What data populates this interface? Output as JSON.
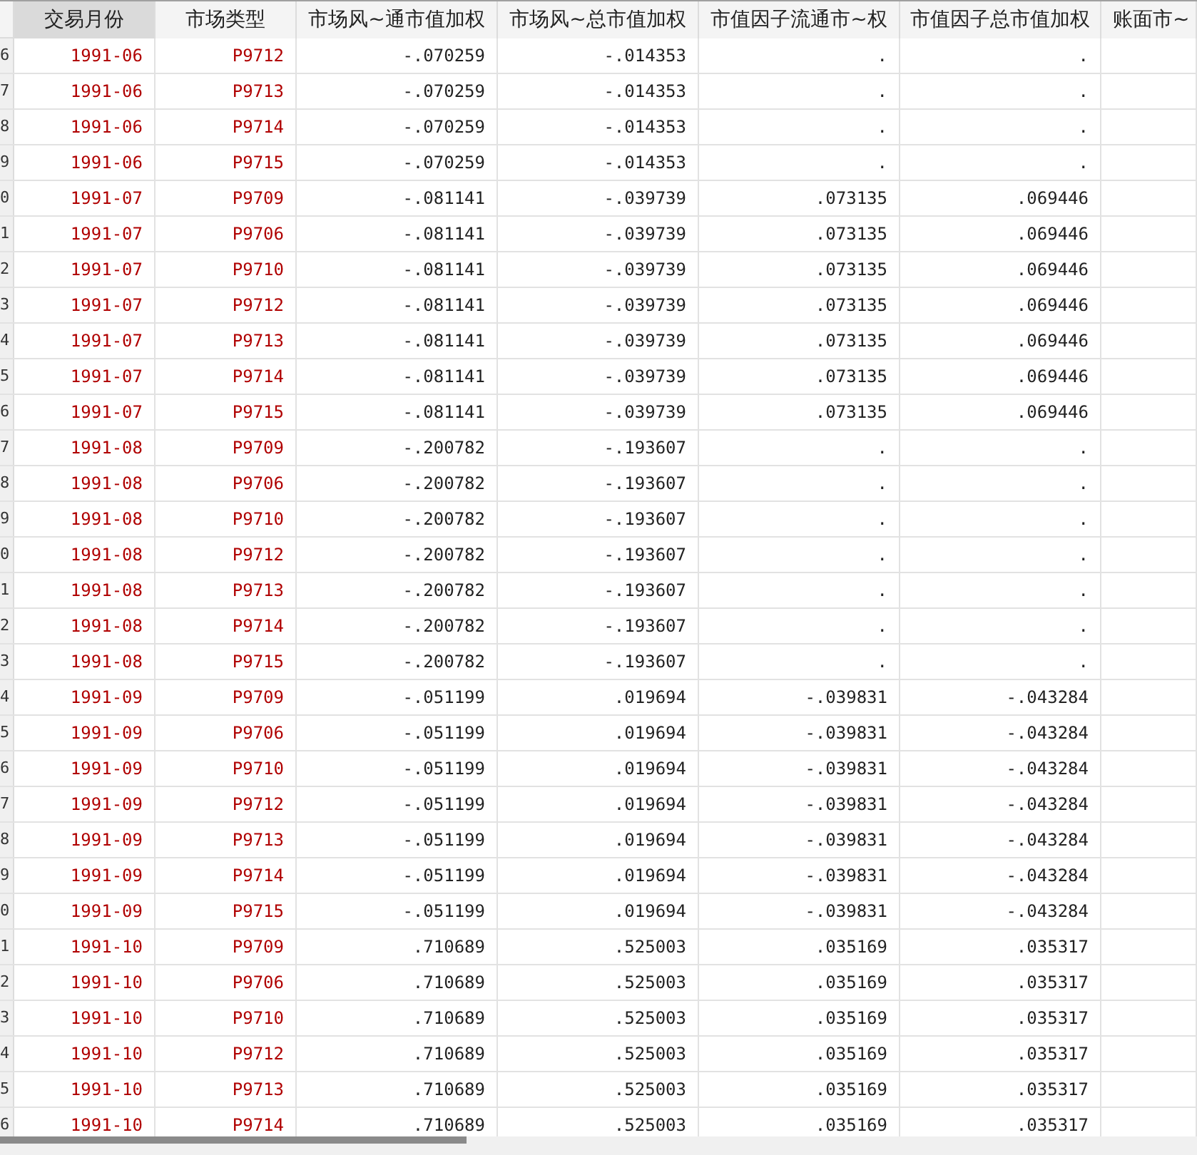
{
  "columns": [
    {
      "label": "交易月份",
      "selected": true
    },
    {
      "label": "市场类型",
      "selected": false
    },
    {
      "label": "市场风~通市值加权",
      "selected": false
    },
    {
      "label": "市场风~总市值加权",
      "selected": false
    },
    {
      "label": "市值因子流通市~权",
      "selected": false
    },
    {
      "label": "市值因子总市值加权",
      "selected": false
    },
    {
      "label": "账面市~",
      "selected": false
    }
  ],
  "rows": [
    {
      "row_number": "6",
      "cells": [
        "1991-06",
        "P9712",
        "-.070259",
        "-.014353",
        ".",
        "."
      ]
    },
    {
      "row_number": "7",
      "cells": [
        "1991-06",
        "P9713",
        "-.070259",
        "-.014353",
        ".",
        "."
      ]
    },
    {
      "row_number": "8",
      "cells": [
        "1991-06",
        "P9714",
        "-.070259",
        "-.014353",
        ".",
        "."
      ]
    },
    {
      "row_number": "9",
      "cells": [
        "1991-06",
        "P9715",
        "-.070259",
        "-.014353",
        ".",
        "."
      ]
    },
    {
      "row_number": "0",
      "cells": [
        "1991-07",
        "P9709",
        "-.081141",
        "-.039739",
        ".073135",
        ".069446"
      ]
    },
    {
      "row_number": "1",
      "cells": [
        "1991-07",
        "P9706",
        "-.081141",
        "-.039739",
        ".073135",
        ".069446"
      ]
    },
    {
      "row_number": "2",
      "cells": [
        "1991-07",
        "P9710",
        "-.081141",
        "-.039739",
        ".073135",
        ".069446"
      ]
    },
    {
      "row_number": "3",
      "cells": [
        "1991-07",
        "P9712",
        "-.081141",
        "-.039739",
        ".073135",
        ".069446"
      ]
    },
    {
      "row_number": "4",
      "cells": [
        "1991-07",
        "P9713",
        "-.081141",
        "-.039739",
        ".073135",
        ".069446"
      ]
    },
    {
      "row_number": "5",
      "cells": [
        "1991-07",
        "P9714",
        "-.081141",
        "-.039739",
        ".073135",
        ".069446"
      ]
    },
    {
      "row_number": "6",
      "cells": [
        "1991-07",
        "P9715",
        "-.081141",
        "-.039739",
        ".073135",
        ".069446"
      ]
    },
    {
      "row_number": "7",
      "cells": [
        "1991-08",
        "P9709",
        "-.200782",
        "-.193607",
        ".",
        "."
      ]
    },
    {
      "row_number": "8",
      "cells": [
        "1991-08",
        "P9706",
        "-.200782",
        "-.193607",
        ".",
        "."
      ]
    },
    {
      "row_number": "9",
      "cells": [
        "1991-08",
        "P9710",
        "-.200782",
        "-.193607",
        ".",
        "."
      ]
    },
    {
      "row_number": "0",
      "cells": [
        "1991-08",
        "P9712",
        "-.200782",
        "-.193607",
        ".",
        "."
      ]
    },
    {
      "row_number": "1",
      "cells": [
        "1991-08",
        "P9713",
        "-.200782",
        "-.193607",
        ".",
        "."
      ]
    },
    {
      "row_number": "2",
      "cells": [
        "1991-08",
        "P9714",
        "-.200782",
        "-.193607",
        ".",
        "."
      ]
    },
    {
      "row_number": "3",
      "cells": [
        "1991-08",
        "P9715",
        "-.200782",
        "-.193607",
        ".",
        "."
      ]
    },
    {
      "row_number": "4",
      "cells": [
        "1991-09",
        "P9709",
        "-.051199",
        ".019694",
        "-.039831",
        "-.043284"
      ]
    },
    {
      "row_number": "5",
      "cells": [
        "1991-09",
        "P9706",
        "-.051199",
        ".019694",
        "-.039831",
        "-.043284"
      ]
    },
    {
      "row_number": "6",
      "cells": [
        "1991-09",
        "P9710",
        "-.051199",
        ".019694",
        "-.039831",
        "-.043284"
      ]
    },
    {
      "row_number": "7",
      "cells": [
        "1991-09",
        "P9712",
        "-.051199",
        ".019694",
        "-.039831",
        "-.043284"
      ]
    },
    {
      "row_number": "8",
      "cells": [
        "1991-09",
        "P9713",
        "-.051199",
        ".019694",
        "-.039831",
        "-.043284"
      ]
    },
    {
      "row_number": "9",
      "cells": [
        "1991-09",
        "P9714",
        "-.051199",
        ".019694",
        "-.039831",
        "-.043284"
      ]
    },
    {
      "row_number": "0",
      "cells": [
        "1991-09",
        "P9715",
        "-.051199",
        ".019694",
        "-.039831",
        "-.043284"
      ]
    },
    {
      "row_number": "1",
      "cells": [
        "1991-10",
        "P9709",
        ".710689",
        ".525003",
        ".035169",
        ".035317"
      ]
    },
    {
      "row_number": "2",
      "cells": [
        "1991-10",
        "P9706",
        ".710689",
        ".525003",
        ".035169",
        ".035317"
      ]
    },
    {
      "row_number": "3",
      "cells": [
        "1991-10",
        "P9710",
        ".710689",
        ".525003",
        ".035169",
        ".035317"
      ]
    },
    {
      "row_number": "4",
      "cells": [
        "1991-10",
        "P9712",
        ".710689",
        ".525003",
        ".035169",
        ".035317"
      ]
    },
    {
      "row_number": "5",
      "cells": [
        "1991-10",
        "P9713",
        ".710689",
        ".525003",
        ".035169",
        ".035317"
      ]
    },
    {
      "row_number": "6",
      "cells": [
        "1991-10",
        "P9714",
        ".710689",
        ".525003",
        ".035169",
        ".035317"
      ]
    }
  ]
}
